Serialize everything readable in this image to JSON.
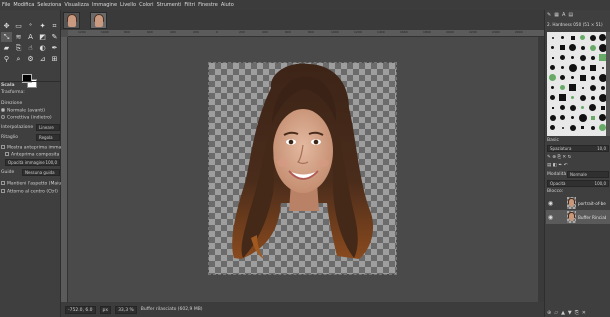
{
  "menu": [
    "File",
    "Modifica",
    "Seleziona",
    "Visualizza",
    "Immagine",
    "Livello",
    "Colori",
    "Strumenti",
    "Filtri",
    "Finestre",
    "Aiuto"
  ],
  "tool_options": {
    "title": "Scala",
    "transform_label": "Trasforma:",
    "direction_label": "Direzione",
    "direction_options": [
      "Normale (avanti)",
      "Correttiva (indietro)"
    ],
    "interpolation_label": "Interpolazione",
    "interpolation_value": "Lineare",
    "clipping_label": "Ritaglio",
    "clipping_value": "Regola",
    "show_preview": "Mostra anteprima immagi",
    "composite_preview": "Anteprima composita",
    "opacity_label": "Opacità immagine",
    "opacity_value": "100,0",
    "guides_label": "Guide",
    "guides_value": "Nessuna guida",
    "keep_aspect": "Mantieni l'aspetto (Maiusc)",
    "around_center": "Attorno al centro (Ctrl)"
  },
  "ruler_ticks": [
    "1200",
    "1000",
    "800",
    "600",
    "400",
    "200",
    "0",
    "200",
    "400",
    "600",
    "800",
    "1000",
    "1200",
    "1400",
    "1600",
    "1800",
    "2000",
    "2200",
    "2400",
    "2600"
  ],
  "status": {
    "coords": "-752.0, 6.0",
    "unit": "px",
    "zoom": "33,3 %",
    "message": "Buffer rilasciato (602,9 MB)"
  },
  "dock": {
    "brush_header": "2. Hardness 050 (51 × 51)",
    "preset": "Basic",
    "spacing_label": "Spaziatura",
    "spacing_value": "10,0",
    "layers_tabs": "Livelli",
    "mode_label": "Modalità",
    "mode_value": "Normale",
    "opacity_label": "Opacità",
    "opacity_value": "100,0",
    "lock_label": "Blocco:",
    "layers": [
      {
        "name": "portrait-of-be",
        "selected": false
      },
      {
        "name": "Buffer Rinciab",
        "selected": true
      }
    ]
  },
  "colors": {
    "foreground": "#000000",
    "background": "#ffffff",
    "ui_bg": "#454545"
  }
}
